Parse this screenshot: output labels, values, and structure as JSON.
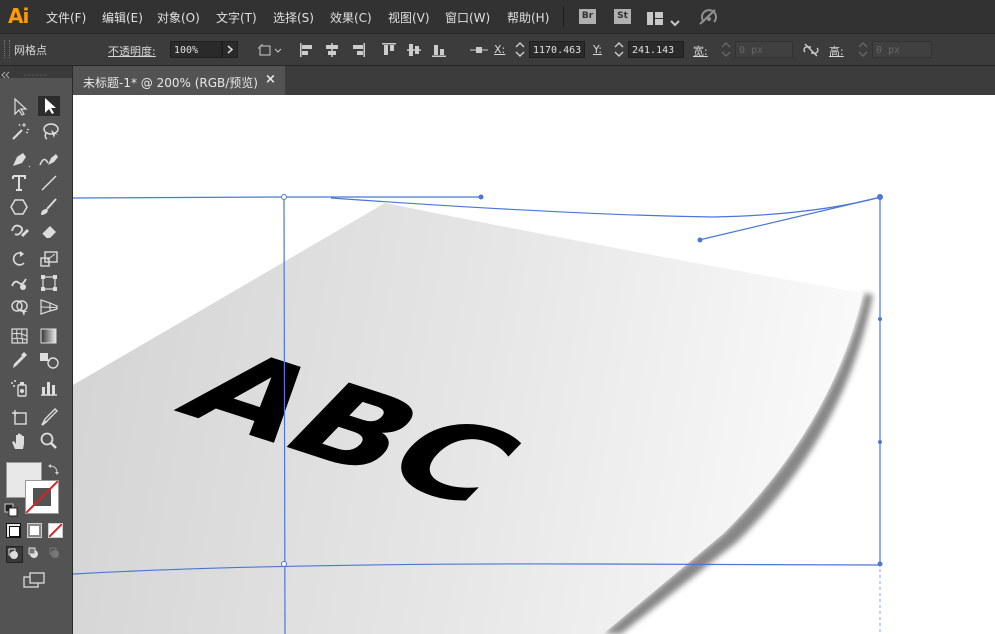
{
  "app": {
    "logo": "Ai",
    "brand_color": "#ff9a00"
  },
  "menu": [
    "文件(F)",
    "编辑(E)",
    "对象(O)",
    "文字(T)",
    "选择(S)",
    "效果(C)",
    "视图(V)",
    "窗口(W)",
    "帮助(H)"
  ],
  "menu_badges": {
    "bridge": "Br",
    "stock": "St"
  },
  "control": {
    "selection_label": "网格点",
    "opacity_label": "不透明度:",
    "opacity_value": "100%",
    "x_label": "X:",
    "x_value": "1170.463",
    "y_label": "Y:",
    "y_value": "241.143",
    "width_label": "宽:",
    "width_value": "0 px",
    "height_label": "高:",
    "height_value": "0 px"
  },
  "document": {
    "tab_title": "未标题-1* @ 200% (RGB/预览)",
    "close": "×"
  },
  "artwork": {
    "text": "ABC",
    "selection_color": "#4a78d8"
  },
  "icons": [
    "selection-tool-icon",
    "direct-selection-tool-icon",
    "magic-wand-icon",
    "lasso-icon",
    "pen-tool-icon",
    "curvature-tool-icon",
    "type-tool-icon",
    "line-tool-icon",
    "shape-tool-icon",
    "paintbrush-icon",
    "shaper-tool-icon",
    "eraser-icon",
    "rotate-tool-icon",
    "scale-tool-icon",
    "warp-tool-icon",
    "free-transform-icon",
    "shape-builder-icon",
    "perspective-grid-icon",
    "mesh-tool-icon",
    "gradient-tool-icon",
    "eyedropper-icon",
    "blend-tool-icon",
    "symbol-sprayer-icon",
    "graph-tool-icon",
    "artboard-tool-icon",
    "slice-tool-icon",
    "hand-tool-icon",
    "zoom-tool-icon"
  ]
}
